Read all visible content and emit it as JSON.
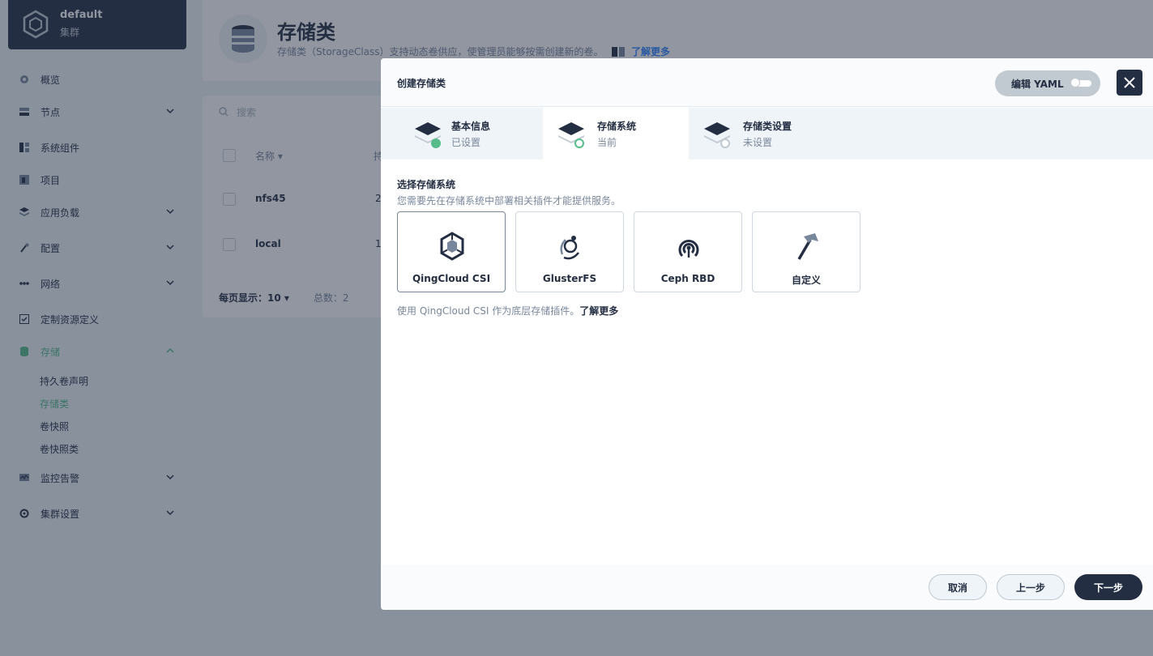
{
  "cluster": {
    "name": "default",
    "subtitle": "集群"
  },
  "nav": {
    "overview": "概览",
    "nodes": "节点",
    "components": "系统组件",
    "projects": "项目",
    "workloads": "应用负载",
    "config": "配置",
    "network": "网络",
    "crd": "定制资源定义",
    "storage": "存储",
    "storage_sub": [
      "持久卷声明",
      "存储类",
      "卷快照",
      "卷快照类"
    ],
    "monitoring": "监控告警",
    "settings": "集群设置"
  },
  "page": {
    "title": "存储类",
    "description": "存储类（StorageClass）支持动态卷供应，使管理员能够按需创建新的卷。",
    "learn_more": "了解更多",
    "search_placeholder": "搜索",
    "col_name": "名称",
    "col_second": "持",
    "rows": [
      {
        "name": "nfs45",
        "value": "2"
      },
      {
        "name": "local",
        "value": "1"
      }
    ],
    "page_size_label": "每页显示：",
    "page_size": "10",
    "total": "总数：2"
  },
  "modal": {
    "title": "创建存储类",
    "edit_yaml": "编辑 YAML",
    "steps": [
      {
        "label": "基本信息",
        "status": "已设置"
      },
      {
        "label": "存储系统",
        "status": "当前"
      },
      {
        "label": "存储类设置",
        "status": "未设置"
      }
    ],
    "section_title": "选择存储系统",
    "section_desc": "您需要先在存储系统中部署相关插件才能提供服务。",
    "cards": [
      "QingCloud CSI",
      "GlusterFS",
      "Ceph RBD",
      "自定义"
    ],
    "note": "使用 QingCloud CSI 作为底层存储插件。",
    "note_more": "了解更多",
    "cancel": "取消",
    "prev": "上一步",
    "next": "下一步"
  },
  "colors": {
    "dark": "#242e42",
    "green": "#55bc8a",
    "muted": "#79879c",
    "bg": "#eff4f9"
  }
}
